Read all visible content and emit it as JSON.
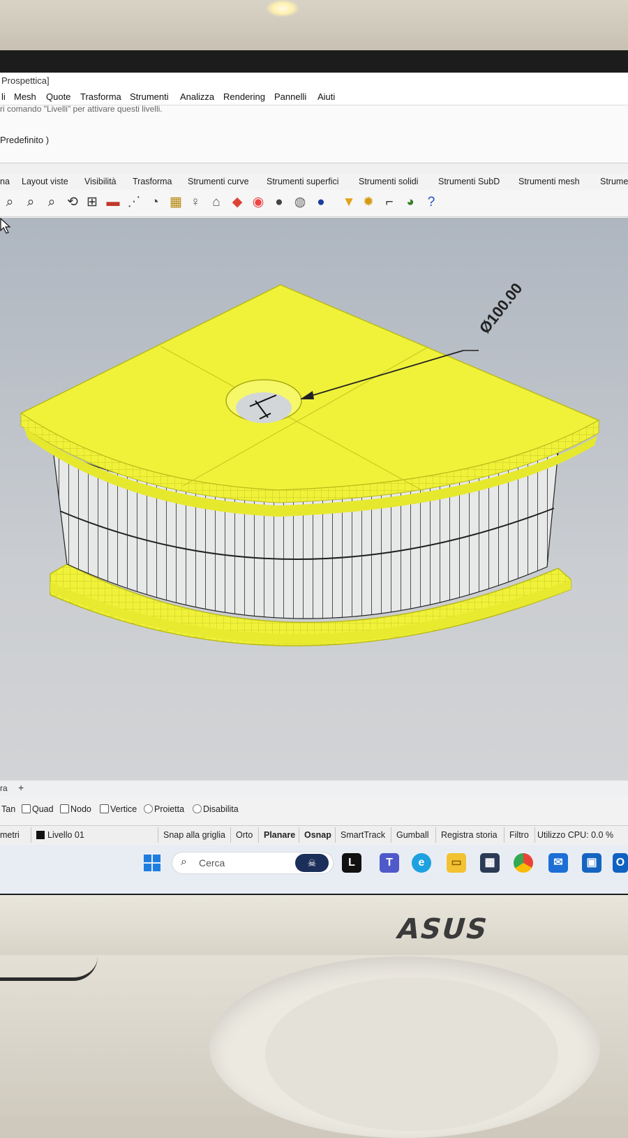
{
  "window": {
    "title": "Prospettica]"
  },
  "menu": [
    "li",
    "Mesh",
    "Quote",
    "Trasforma",
    "Strumenti",
    "Analizza",
    "Rendering",
    "Pannelli",
    "Aiuti"
  ],
  "command": {
    "history": "ri comando \"Livelli\" per attivare questi livelli.",
    "prompt": "Predefinito )"
  },
  "tabs": [
    "na",
    "Layout viste",
    "Visibilità",
    "Trasforma",
    "Strumenti curve",
    "Strumenti superfici",
    "Strumenti solidi",
    "Strumenti SubD",
    "Strumenti mesh",
    "Strume"
  ],
  "toolbar_icons": [
    "zoom-extents-icon",
    "zoom-window-icon",
    "zoom-selected-icon",
    "rotate-view-icon",
    "four-viewports-icon",
    "camera-car-icon",
    "walkabout-icon",
    "set-cplane-icon",
    "named-cplane-icon",
    "light-bulb-icon",
    "lock-icon",
    "render-icon",
    "color-wheel-icon",
    "shaded-sphere-icon",
    "ghosted-sphere-icon",
    "rendered-sphere-icon",
    "filter-icon",
    "settings-gear-icon",
    "options-icon",
    "grasshopper-icon",
    "help-icon"
  ],
  "viewport": {
    "dimension_text": "Ø100.00",
    "model_color": "#f0f23a",
    "viewport_tab": "ra"
  },
  "osnap": {
    "items": [
      {
        "label": "Tan",
        "type": "none"
      },
      {
        "label": "Quad",
        "type": "checkbox"
      },
      {
        "label": "Nodo",
        "type": "checkbox"
      },
      {
        "label": "Vertice",
        "type": "checkbox"
      },
      {
        "label": "Proietta",
        "type": "radio"
      },
      {
        "label": "Disabilita",
        "type": "radio"
      }
    ]
  },
  "status": {
    "units": "metri",
    "layer": "Livello 01",
    "buttons": [
      "Snap alla griglia",
      "Orto",
      "Planare",
      "Osnap",
      "SmartTrack",
      "Gumball",
      "Registra storia",
      "Filtro"
    ],
    "cpu": "Utilizzo CPU: 0.0 %"
  },
  "taskbar": {
    "search_placeholder": "Cerca",
    "apps": [
      "windows-start-icon",
      "pirate-app-icon",
      "l-app-icon",
      "teams-icon",
      "edge-icon",
      "file-explorer-icon",
      "microsoft-store-icon",
      "chrome-icon",
      "mail-icon",
      "remote-desktop-icon",
      "outlook-icon"
    ]
  },
  "monitor": {
    "brand": "ASUS"
  }
}
